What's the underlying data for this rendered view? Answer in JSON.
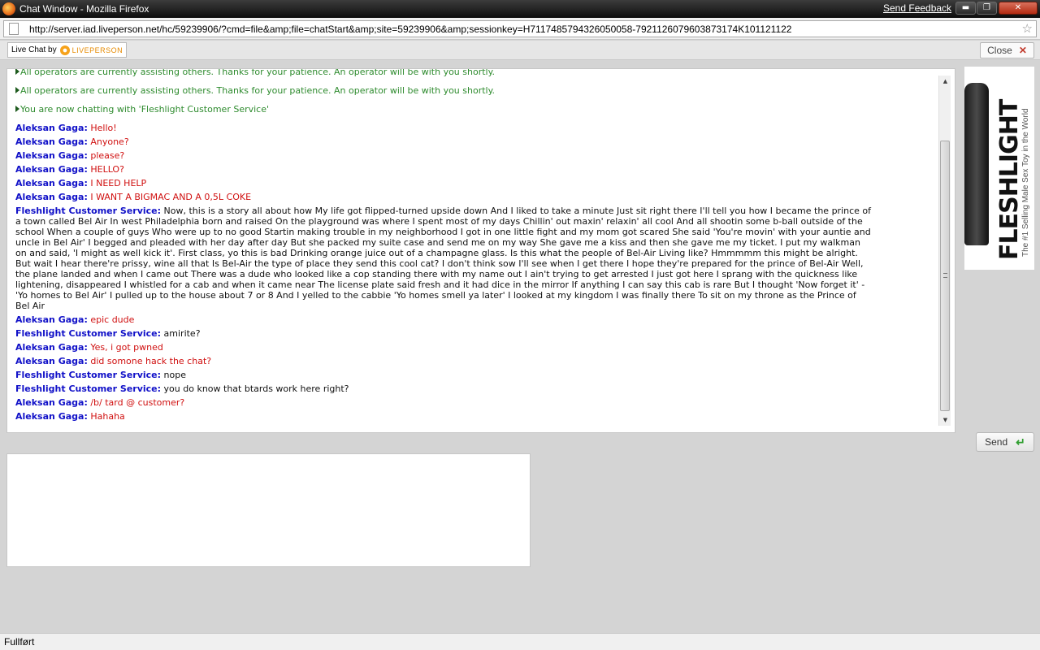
{
  "window": {
    "title": "Chat Window - Mozilla Firefox",
    "send_feedback": "Send Feedback",
    "min_glyph": "▬",
    "max_glyph": "❐",
    "close_glyph": "✕"
  },
  "address_bar": {
    "url": "http://server.iad.liveperson.net/hc/59239906/?cmd=file&amp;file=chatStart&amp;site=59239906&amp;sessionkey=H7117485794326050058-7921126079603873174K101121122"
  },
  "header": {
    "badge_prefix": "Live Chat by",
    "badge_brand": "LIVEPERSON",
    "close_label": "Close",
    "close_icon": "✕"
  },
  "transcript": {
    "system_messages": [
      "All operators are currently assisting others. Thanks for your patience. An operator will be with you shortly.",
      "All operators are currently assisting others. Thanks for your patience. An operator will be with you shortly.",
      "You are now chatting with 'Fleshlight Customer Service'"
    ],
    "messages": [
      {
        "sender": "Aleksan Gaga:",
        "role": "visitor",
        "text": "Hello!"
      },
      {
        "sender": "Aleksan Gaga:",
        "role": "visitor",
        "text": "Anyone?"
      },
      {
        "sender": "Aleksan Gaga:",
        "role": "visitor",
        "text": "please?"
      },
      {
        "sender": "Aleksan Gaga:",
        "role": "visitor",
        "text": "HELLO?"
      },
      {
        "sender": "Aleksan Gaga:",
        "role": "visitor",
        "text": "I NEED HELP"
      },
      {
        "sender": "Aleksan Gaga:",
        "role": "visitor",
        "text": "I WANT A BIGMAC AND A 0,5L COKE"
      },
      {
        "sender": "Fleshlight Customer Service:",
        "role": "agent",
        "text": "Now, this is a story all about how My life got flipped-turned upside down And I liked to take a minute Just sit right there I'll tell you how I became the prince of a town called Bel Air In west Philadelphia born and raised On the playground was where I spent most of my days Chillin' out maxin' relaxin' all cool And all shootin some b-ball outside of the school When a couple of guys Who were up to no good Startin making trouble in my neighborhood I got in one little fight and my mom got scared She said 'You're movin' with your auntie and uncle in Bel Air' I begged and pleaded with her day after day But she packed my suite case and send me on my way She gave me a kiss and then she gave me my ticket. I put my walkman on and said, 'I might as well kick it'. First class, yo this is bad Drinking orange juice out of a champagne glass. Is this what the people of Bel-Air Living like? Hmmmmm this might be alright. But wait I hear there're prissy, wine all that Is Bel-Air the type of place they send this cool cat? I don't think sow I'll see when I get there I hope they're prepared for the prince of Bel-Air Well, the plane landed and when I came out There was a dude who looked like a cop standing there with my name out I ain't trying to get arrested I just got here I sprang with the quickness like lightening, disappeared I whistled for a cab and when it came near The license plate said fresh and it had dice in the mirror If anything I can say this cab is rare But I thought 'Now forget it' - 'Yo homes to Bel Air' I pulled up to the house about 7 or 8 And I yelled to the cabbie 'Yo homes smell ya later' I looked at my kingdom I was finally there To sit on my throne as the Prince of Bel Air"
      },
      {
        "sender": "Aleksan Gaga:",
        "role": "visitor",
        "text": "epic dude"
      },
      {
        "sender": "Fleshlight Customer Service:",
        "role": "agent",
        "text": "amirite?"
      },
      {
        "sender": "Aleksan Gaga:",
        "role": "visitor",
        "text": "Yes, i got pwned"
      },
      {
        "sender": "Aleksan Gaga:",
        "role": "visitor",
        "text": "did somone hack the chat?"
      },
      {
        "sender": "Fleshlight Customer Service:",
        "role": "agent",
        "text": "nope"
      },
      {
        "sender": "Fleshlight Customer Service:",
        "role": "agent",
        "text": "you do know that btards work here right?"
      },
      {
        "sender": "Aleksan Gaga:",
        "role": "visitor",
        "text": "/b/ tard @ customer?"
      },
      {
        "sender": "Aleksan Gaga:",
        "role": "visitor",
        "text": "Hahaha"
      }
    ]
  },
  "ad": {
    "brand": "FLESHLIGHT",
    "tagline": "The #1 Selling Male Sex Toy in the World"
  },
  "composer": {
    "value": "",
    "send_label": "Send",
    "send_icon": "↵"
  },
  "status_bar": {
    "text": "Fullført"
  },
  "colors": {
    "visitor_name": "#1111c8",
    "visitor_text": "#d01010",
    "system_text": "#2e8b2e",
    "brand_orange": "#f6a21a"
  }
}
